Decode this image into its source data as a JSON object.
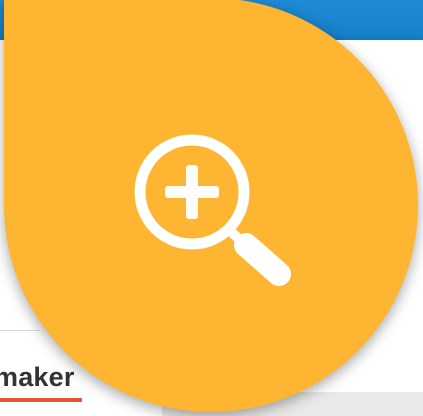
{
  "page": {
    "title_fragment": "maker"
  },
  "zoom_button": {
    "icon": "zoom-in-icon",
    "color": "#fdb532",
    "icon_color": "#ffffff"
  },
  "colors": {
    "top_bar": "#1780c8",
    "accent": "#f3a93a",
    "underline": "#e4572e",
    "text": "#333333"
  }
}
